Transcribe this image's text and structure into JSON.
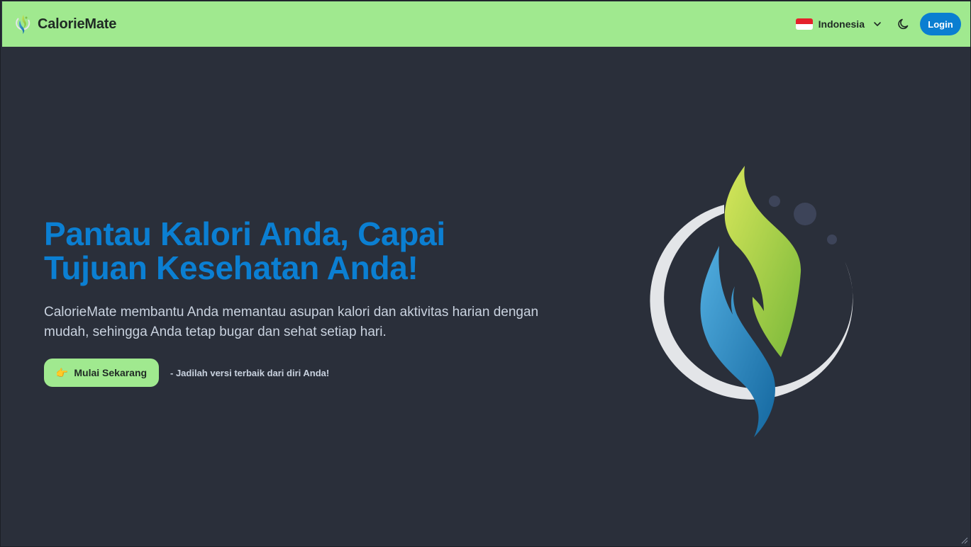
{
  "app": {
    "name": "CalorieMate"
  },
  "navbar": {
    "language": "Indonesia",
    "login_label": "Login"
  },
  "hero": {
    "title_line1": "Pantau Kalori Anda, Capai",
    "title_line2": "Tujuan Kesehatan Anda!",
    "description": "CalorieMate membantu Anda memantau asupan kalori dan aktivitas harian dengan mudah, sehingga Anda tetap bugar dan sehat setiap hari.",
    "cta_label": "Mulai Sekarang",
    "cta_icon": "👉",
    "tagline": "- Jadilah versi terbaik dari diri Anda!"
  },
  "colors": {
    "navbar_bg": "#a0e98f",
    "page_bg": "#2a2f3a",
    "accent_blue": "#0b7fd2",
    "text_light": "#c9d2df"
  },
  "icons": {
    "brand": "leaf-hands-logo-icon",
    "flag": "indonesia-flag-icon",
    "language_dropdown": "chevron-down-icon",
    "theme_toggle": "moon-icon",
    "cta": "pointing-hand-icon"
  }
}
